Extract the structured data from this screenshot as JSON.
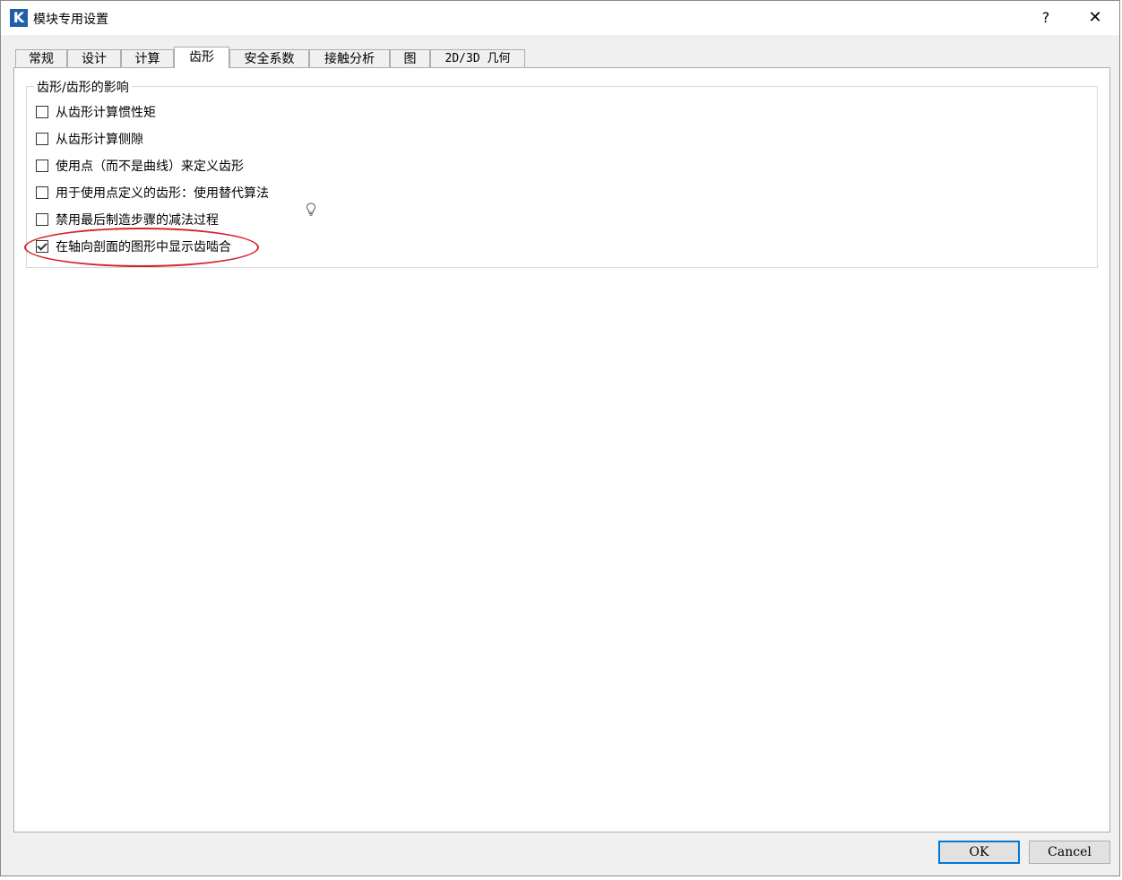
{
  "window": {
    "title": "模块专用设置",
    "app_icon_letter": "K",
    "help_label": "?",
    "close_label": "✕"
  },
  "tabs": [
    {
      "label": "常规"
    },
    {
      "label": "设计"
    },
    {
      "label": "计算"
    },
    {
      "label": "齿形",
      "active": true
    },
    {
      "label": "安全系数"
    },
    {
      "label": "接触分析"
    },
    {
      "label": "图"
    },
    {
      "label": "2D/3D 几何"
    }
  ],
  "group": {
    "title": "齿形/齿形的影响",
    "options": [
      {
        "label": "从齿形计算惯性矩",
        "checked": false
      },
      {
        "label": "从齿形计算侧隙",
        "checked": false
      },
      {
        "label": "使用点（而不是曲线）来定义齿形",
        "checked": false
      },
      {
        "label": "用于使用点定义的齿形：使用替代算法",
        "checked": false
      },
      {
        "label": "禁用最后制造步骤的减法过程",
        "checked": false
      },
      {
        "label": "在轴向剖面的图形中显示齿啮合",
        "checked": true
      }
    ],
    "hint_icon": "lightbulb-icon"
  },
  "annotation": {
    "color": "#d6252b"
  },
  "buttons": {
    "ok_label": "OK",
    "cancel_label": "Cancel"
  },
  "colors": {
    "accent": "#0078d7",
    "icon_bg": "#1f5fa8"
  }
}
